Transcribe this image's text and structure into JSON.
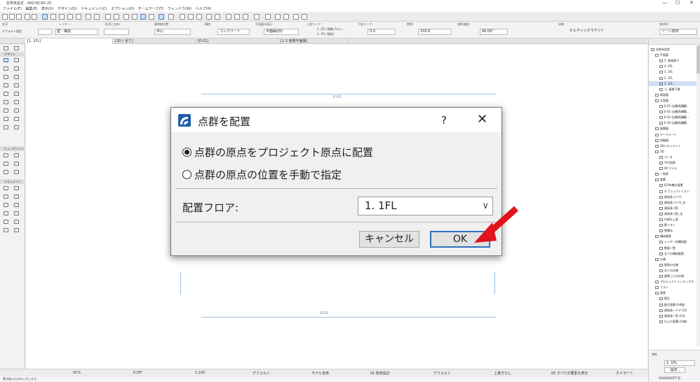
{
  "window": {
    "title": "名称未設定 - ARCHICAD 20",
    "controls": [
      "—",
      "☐",
      "✕"
    ]
  },
  "menu": [
    "ファイル(F)",
    "編集(E)",
    "表示(V)",
    "デザイン(D)",
    "ドキュメント(C)",
    "オプション(O)",
    "チームワーク(T)",
    "ウィンドウ(W)",
    "ヘルプ(H)"
  ],
  "infobox": {
    "labels": [
      "矢印",
      "レイヤー:",
      "形状と方向:",
      "基準線位置:",
      "構造:",
      "平面図の表示:",
      "上部リンク:",
      "下部リンク:",
      "壁厚:",
      "傾斜/複合:",
      "材質:",
      "部材ID:"
    ],
    "layer_value": "壁 - 構造",
    "ref_line": "中心",
    "structure": "コンクリート",
    "floor_plan": "平面図(旧)",
    "top_link_value": "2. 2FL (現階プロジ...",
    "home_story": "1. 1FL (現在)",
    "offset": "0.0",
    "thickness": "150.0",
    "angle": "90.00°",
    "material": "ビルディングマテリアル",
    "partition": "ゾーン境界",
    "default_label": "デフォルト設定"
  },
  "tabs": [
    "[1. 1FL]",
    "[3D / 全て]",
    "[E-01]",
    "[1.3 各階平面図]"
  ],
  "toolbox": {
    "sections": [
      "デザイン",
      "ビューポイント",
      "ドキュメント"
    ]
  },
  "canvas": {
    "marker_top": "E-03",
    "marker_bottom": "E-01"
  },
  "navigator": {
    "items": [
      {
        "label": "名称未設定",
        "indent": 0,
        "selected": false
      },
      {
        "label": "平面図",
        "indent": 1,
        "selected": false
      },
      {
        "label": "5. 屋根高さ",
        "indent": 2,
        "selected": false
      },
      {
        "label": "4. 4FL",
        "indent": 2,
        "selected": false
      },
      {
        "label": "3. 3FL",
        "indent": 2,
        "selected": false
      },
      {
        "label": "2. 2FL",
        "indent": 2,
        "selected": false
      },
      {
        "label": "1. 1FL",
        "indent": 2,
        "selected": true
      },
      {
        "label": "-1. 基礎下端",
        "indent": 2,
        "selected": false
      },
      {
        "label": "断面図",
        "indent": 1,
        "selected": false
      },
      {
        "label": "立面図",
        "indent": 1,
        "selected": false
      },
      {
        "label": "E-01 (自動再構築…",
        "indent": 2,
        "selected": false
      },
      {
        "label": "E-02 (自動再構築…",
        "indent": 2,
        "selected": false
      },
      {
        "label": "E-03 (自動再構築…",
        "indent": 2,
        "selected": false
      },
      {
        "label": "E-04 (自動再構築…",
        "indent": 2,
        "selected": false
      },
      {
        "label": "展開図",
        "indent": 1,
        "selected": false
      },
      {
        "label": "ワークシート",
        "indent": 1,
        "selected": false
      },
      {
        "label": "詳細図",
        "indent": 1,
        "selected": false
      },
      {
        "label": "3Dドキュメント",
        "indent": 1,
        "selected": false
      },
      {
        "label": "3D",
        "indent": 1,
        "selected": false
      },
      {
        "label": "パース",
        "indent": 2,
        "selected": false
      },
      {
        "label": "平行投影",
        "indent": 2,
        "selected": false
      },
      {
        "label": "00 カメラ",
        "indent": 2,
        "selected": false
      },
      {
        "label": "一覧表",
        "indent": 1,
        "selected": false
      },
      {
        "label": "要素",
        "indent": 1,
        "selected": false
      },
      {
        "label": "ECMs集計要素",
        "indent": 2,
        "selected": false
      },
      {
        "label": "オブジェクトリスト",
        "indent": 2,
        "selected": false
      },
      {
        "label": "建具表 (ドア)",
        "indent": 2,
        "selected": false
      },
      {
        "label": "建具表 (ドア)_夫",
        "indent": 2,
        "selected": false
      },
      {
        "label": "建具表 (窓)",
        "indent": 2,
        "selected": false
      },
      {
        "label": "建具表 (窓)_夫",
        "indent": 2,
        "selected": false
      },
      {
        "label": "内部仕上表",
        "indent": 2,
        "selected": false
      },
      {
        "label": "壁リスト",
        "indent": 2,
        "selected": false
      },
      {
        "label": "壁構法",
        "indent": 2,
        "selected": false
      },
      {
        "label": "構成要素",
        "indent": 1,
        "selected": false
      },
      {
        "label": "レイヤー別構成要",
        "indent": 2,
        "selected": false
      },
      {
        "label": "数量一覧",
        "indent": 2,
        "selected": false
      },
      {
        "label": "全ての構成要素",
        "indent": 2,
        "selected": false
      },
      {
        "label": "仕様",
        "indent": 1,
        "selected": false
      },
      {
        "label": "建具の仕様",
        "indent": 2,
        "selected": false
      },
      {
        "label": "全ての仕様",
        "indent": 2,
        "selected": false
      },
      {
        "label": "要素ごとの仕様",
        "indent": 2,
        "selected": false
      },
      {
        "label": "プロジェクトインデックス",
        "indent": 1,
        "selected": false
      },
      {
        "label": "リスト",
        "indent": 1,
        "selected": false
      },
      {
        "label": "要素",
        "indent": 1,
        "selected": false
      },
      {
        "label": "壁芯",
        "indent": 2,
        "selected": false
      },
      {
        "label": "配付面積 (A4縦)",
        "indent": 2,
        "selected": false
      },
      {
        "label": "建具表一ドア (A3",
        "indent": 2,
        "selected": false
      },
      {
        "label": "建具表一窓 (A3)",
        "indent": 2,
        "selected": false
      },
      {
        "label": "仕上げ面積 (A4縦",
        "indent": 2,
        "selected": false
      }
    ],
    "props_label": "特性",
    "props_value": "1. 1FL",
    "settings_btn": "設定...",
    "brand": "GRAPHISOFT ID"
  },
  "statusbar": {
    "zoom": "91%",
    "angle": "0.00°",
    "scale": "1:100",
    "default1": "デフォルト",
    "model": "モデル全体",
    "renovation": "01 既存設計",
    "default2": "デフォルト",
    "overwrite": "上書きなし",
    "show": "00 すべての要素を表示",
    "camera": "カメラ一ト"
  },
  "message": "置き換えの点を入力します。",
  "dialog": {
    "title": "点群を配置",
    "help": "?",
    "close": "✕",
    "option1": "点群の原点をプロジェクト原点に配置",
    "option2": "点群の原点の位置を手動で指定",
    "selected_option": 1,
    "floor_label": "配置フロア:",
    "floor_value": "1. 1FL",
    "cancel": "キャンセル",
    "ok": "OK"
  },
  "accent": {
    "arrow": "#e0141c",
    "ok_border": "#2d6fc0",
    "selection": "#cfe0f5"
  }
}
